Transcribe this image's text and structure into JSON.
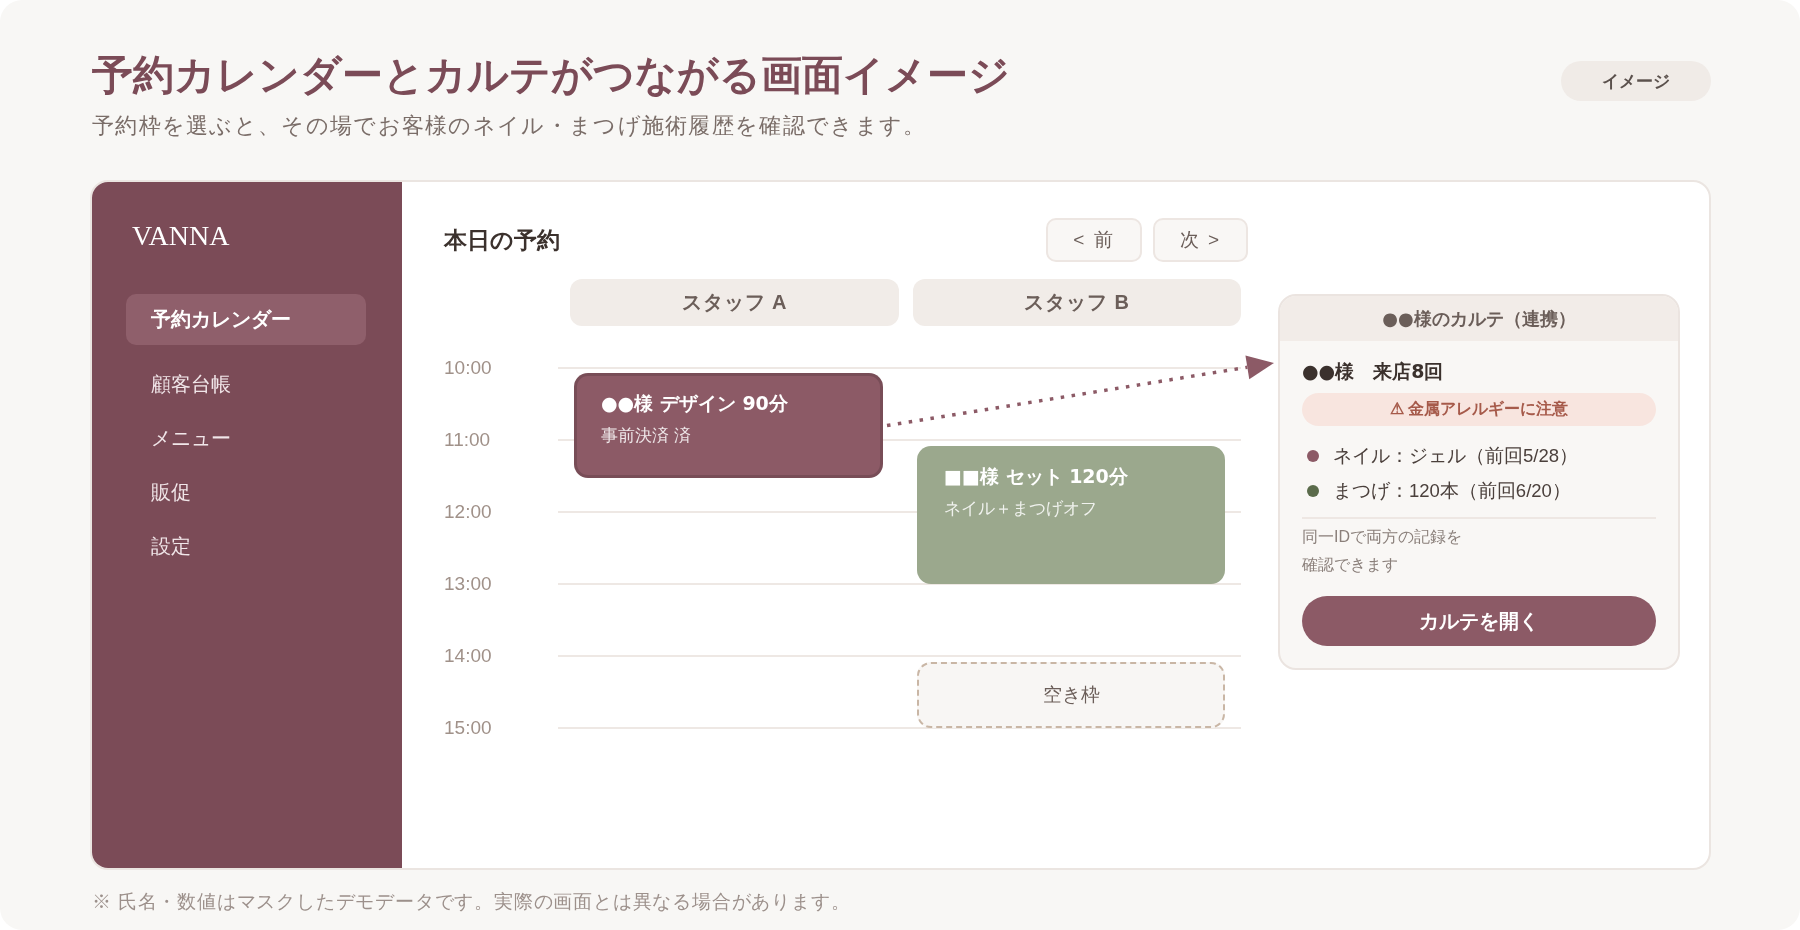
{
  "header": {
    "title": "予約カレンダーとカルテがつながる画面イメージ",
    "subtitle": "予約枠を選ぶと、その場でお客様のネイル・まつげ施術履歴を確認できます。",
    "badge": "イメージ"
  },
  "sidebar": {
    "logo": "VANNA",
    "items": [
      {
        "label": "予約カレンダー",
        "selected": true
      },
      {
        "label": "顧客台帳",
        "selected": false
      },
      {
        "label": "メニュー",
        "selected": false
      },
      {
        "label": "販促",
        "selected": false
      },
      {
        "label": "設定",
        "selected": false
      }
    ]
  },
  "schedule": {
    "title": "本日の予約",
    "nav_buttons": [
      "< 前",
      "次 >"
    ],
    "time_labels": [
      "10:00",
      "11:00",
      "12:00",
      "13:00",
      "14:00",
      "15:00"
    ],
    "staff": [
      {
        "name": "スタッフ A",
        "events": [
          {
            "kind": "booking",
            "title": "●●様 デザイン 90分",
            "detail": "事前決済 済",
            "color": "#8c5a66",
            "selected": true
          }
        ]
      },
      {
        "name": "スタッフ B",
        "events": [
          {
            "kind": "booking",
            "title": "■■様 セット 120分",
            "detail": "ネイル＋まつげオフ",
            "color": "#9ba88d",
            "selected": false
          },
          {
            "kind": "free",
            "label": "空き枠"
          }
        ]
      }
    ]
  },
  "karte": {
    "title": "●●様のカルテ（連携）",
    "customer": "●●様　来店8回",
    "alert": "⚠ 金属アレルギーに注意",
    "history": [
      {
        "text": "ネイル：ジェル（前回5/28）",
        "color": "#8c5a66"
      },
      {
        "text": "まつげ：120本（前回6/20）",
        "color": "#5b6b4b"
      }
    ],
    "note": "同一IDで両方の記録を確認できます",
    "button": "カルテを開く"
  },
  "footnote": "※ 氏名・数値はマスクしたデモデータです。実際の画面とは異なる場合があります。"
}
